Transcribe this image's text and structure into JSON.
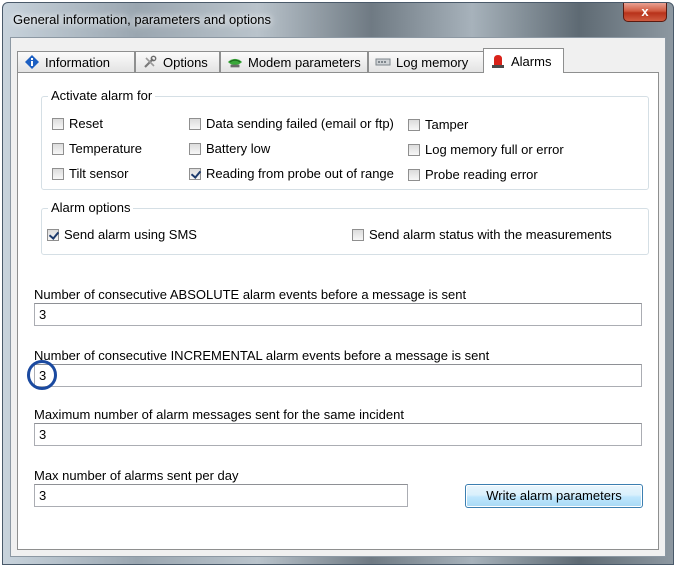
{
  "window": {
    "title": "General information, parameters and options",
    "close_label": "x"
  },
  "tabs": [
    {
      "label": "Information",
      "icon": "info-icon",
      "active": false
    },
    {
      "label": "Options",
      "icon": "tools-icon",
      "active": false
    },
    {
      "label": "Modem parameters",
      "icon": "modem-icon",
      "active": false
    },
    {
      "label": "Log memory",
      "icon": "memory-icon",
      "active": false
    },
    {
      "label": "Alarms",
      "icon": "alarm-bell-icon",
      "active": true
    }
  ],
  "activate_alarm": {
    "legend": "Activate alarm for",
    "items": [
      {
        "label": "Reset",
        "checked": false
      },
      {
        "label": "Temperature",
        "checked": false
      },
      {
        "label": "Tilt sensor",
        "checked": false
      },
      {
        "label": "Data sending failed (email or ftp)",
        "checked": false
      },
      {
        "label": "Battery low",
        "checked": false
      },
      {
        "label": "Reading from probe out of range",
        "checked": true
      },
      {
        "label": "Tamper",
        "checked": false
      },
      {
        "label": "Log memory full or error",
        "checked": false
      },
      {
        "label": "Probe reading error",
        "checked": false
      }
    ]
  },
  "alarm_options": {
    "legend": "Alarm options",
    "items": [
      {
        "label": "Send alarm using SMS",
        "checked": true
      },
      {
        "label": "Send alarm status with the measurements",
        "checked": false
      }
    ]
  },
  "fields": [
    {
      "label": "Number of consecutive ABSOLUTE alarm events before a message is sent",
      "value": "3"
    },
    {
      "label": "Number of consecutive INCREMENTAL alarm events before a message is sent",
      "value": "3"
    },
    {
      "label": "Maximum number of alarm messages sent for the same incident",
      "value": "3"
    },
    {
      "label": "Max number of alarms sent per day",
      "value": "3"
    }
  ],
  "write_button": {
    "label": "Write alarm parameters"
  },
  "colors": {
    "accent": "#1b4aa0",
    "close": "#c8432a"
  }
}
